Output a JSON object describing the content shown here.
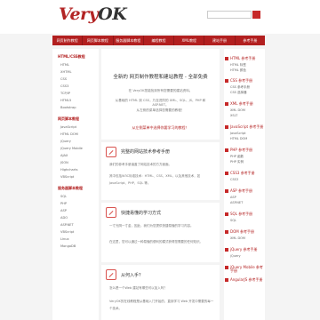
{
  "header": {
    "logo_very": "Very",
    "logo_ok": "OK",
    "search_placeholder": ""
  },
  "nav": [
    "网页制作教程",
    "网页脚本教程",
    "服务器脚本教程",
    "编程教程",
    "XML教程",
    "建站手册",
    "参考手册"
  ],
  "left": {
    "section1": "HTML/CSS教程",
    "items1": [
      "HTML",
      "XHTML",
      "CSS",
      "CSS3",
      "TCP/IP",
      "HTML5",
      "Bootstrap"
    ],
    "section2": "网页脚本教程",
    "items2": [
      "JavaScript",
      "HTML DOM",
      "jQuery",
      "jQuery Mobile",
      "AJAX",
      "JSON",
      "Highcharts",
      "VBScript"
    ],
    "section3": "服务器脚本教程",
    "items3": [
      "SQL",
      "PHP",
      "ASP",
      "ADO",
      "ASP.NET",
      "VBScript",
      "Linux",
      "MongoDB"
    ]
  },
  "main": {
    "hero_title": "全新的 网页制作教程和建站教程 - 全部免费",
    "hero_lines": [
      "在 VeryOK您能找到所有您需要的建站资料。",
      "从基础的 HTML 到 CSS，乃至进阶的 XML、SQL、JS、PHP 和 ASP.NET。",
      "从左侧的菜单选择您需要的教程！"
    ],
    "hero_highlight": "从左侧菜单中选择你要学习的教程！",
    "sec1_title": "完整的网站技术参考手册",
    "sec1_lines": [
      "我们的参考手册涵盖了网站技术的方方面面。",
      "其中包括W3C标准技术：HTML、CSS、XML，以及其他技术，如 JavaScript、PHP、SQL 等。"
    ],
    "sec2_title": "快捷易懂的学习方式",
    "sec2_lines": [
      "一寸光阴一寸金，因此，我们为您提供快捷易懂的学习内容。",
      "在这里，您可以通过一种易懂的便利的模式获得您需要的任何知识。"
    ],
    "sec3_title": "从何入手？",
    "sec3_lines": [
      "怎么是一个Web 建站有哪些可以加入吗？",
      "VeryOK的在线教程是从基础入门开始的，直到学习 Web 开发中需要的每一个技术。"
    ]
  },
  "right": {
    "groups": [
      {
        "title": "HTML 参考手册",
        "items": [
          "HTML 标签",
          "HTML 颜色"
        ]
      },
      {
        "title": "CSS 参考手册",
        "items": [
          "CSS 参考手册",
          "CSS 选择器"
        ]
      },
      {
        "title": "XML 参考手册",
        "items": [
          "XML DOM",
          "XSLT"
        ]
      },
      {
        "title": "JavaScript 参考手册",
        "items": [
          "JavaScript",
          "HTML DOM"
        ]
      },
      {
        "title": "PHP 参考手册",
        "items": [
          "PHP 函数",
          "PHP 实例"
        ]
      },
      {
        "title": "CSS3 参考手册",
        "items": [
          "CSS3"
        ]
      },
      {
        "title": "ASP 参考手册",
        "items": [
          "ASP",
          "ASP.NET"
        ]
      },
      {
        "title": "SQL 参考手册",
        "items": [
          "SQL"
        ]
      },
      {
        "title": "DOM 参考手册",
        "items": [
          "XML DOM"
        ]
      },
      {
        "title": "jQuery 参考手册",
        "items": [
          "jQuery"
        ]
      },
      {
        "title": "jQuery Mobile 参考手册",
        "items": []
      },
      {
        "title": "AngularJS 参考手册",
        "items": []
      }
    ]
  }
}
